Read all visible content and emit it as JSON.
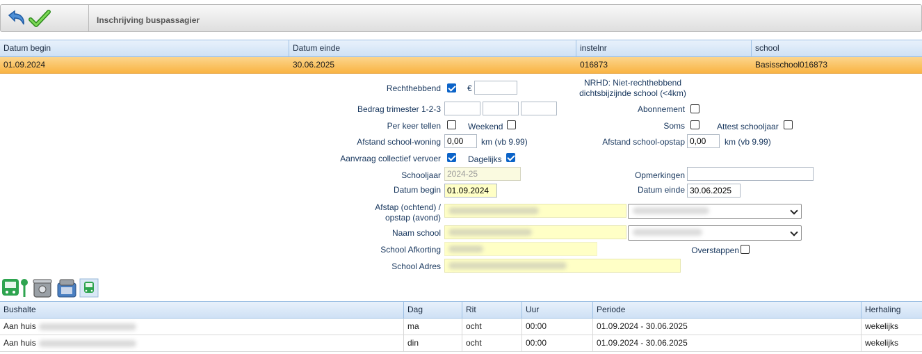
{
  "toolbar": {
    "title": "Inschrijving buspassagier",
    "undo_icon": "undo-icon",
    "save_icon": "checkmark-icon"
  },
  "top_grid": {
    "columns": [
      "Datum begin",
      "Datum einde",
      "instelnr",
      "school"
    ],
    "row": [
      "01.09.2024",
      "30.06.2025",
      "016873",
      "Basisschool016873"
    ]
  },
  "form": {
    "rechthebbend_label": "Rechthebbend",
    "rechthebbend_checked": true,
    "euro": "€",
    "nrhd_line1": "NRHD: Niet-rechthebbend",
    "nrhd_line2": "dichtsbijzijnde school (<4km)",
    "bedrag_label": "Bedrag trimester 1-2-3",
    "abonnement_label": "Abonnement",
    "perkeer_label": "Per keer tellen",
    "weekend_label": "Weekend",
    "soms_label": "Soms",
    "attest_label": "Attest schooljaar",
    "afstand_woning_label": "Afstand school-woning",
    "afstand_woning_value": "0,00",
    "km_hint": "km (vb 9.99)",
    "afstand_opstap_label": "Afstand school-opstap",
    "afstand_opstap_value": "0,00",
    "aanvraag_label": "Aanvraag collectief vervoer",
    "aanvraag_checked": true,
    "dagelijks_label": "Dagelijks",
    "dagelijks_checked": true,
    "schooljaar_label": "Schooljaar",
    "schooljaar_value": "2024-25",
    "opmerkingen_label": "Opmerkingen",
    "datum_begin_label": "Datum begin",
    "datum_begin_value": "01.09.2024",
    "datum_einde_label": "Datum einde",
    "datum_einde_value": "30.06.2025",
    "afstap_label_1": "Afstap (ochtend) /",
    "afstap_label_2": "opstap (avond)",
    "naam_school_label": "Naam school",
    "school_afkorting_label": "School Afkorting",
    "overstappen_label": "Overstappen",
    "school_adres_label": "School Adres"
  },
  "icon_bar": [
    "bus-stop-icon",
    "bin-icon",
    "bin-stack-icon",
    "bus-icon"
  ],
  "bottom_grid": {
    "columns": [
      "Bushalte",
      "Dag",
      "Rit",
      "Uur",
      "Periode",
      "Herhaling"
    ],
    "rows": [
      [
        "Aan huis",
        "ma",
        "ocht",
        "00:00",
        "01.09.2024 - 30.06.2025",
        "wekelijks"
      ],
      [
        "Aan huis",
        "din",
        "ocht",
        "00:00",
        "01.09.2024 - 30.06.2025",
        "wekelijks"
      ]
    ]
  },
  "colors": {
    "header_blue": "#cfe1f5",
    "selected_row": "#f9b443",
    "required_yellow": "#ffffc6",
    "checkbox_blue": "#0b63c8"
  }
}
